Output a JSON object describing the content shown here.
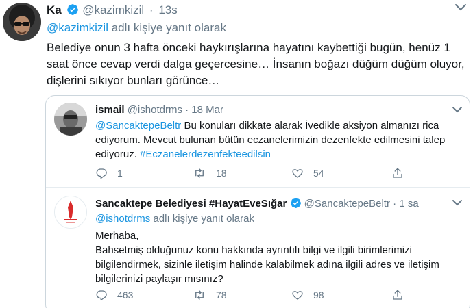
{
  "main_tweet": {
    "name": "Ka",
    "handle": "@kazimkizil",
    "separator": "·",
    "time": "13s",
    "reply_handle": "@kazimkizil",
    "reply_suffix": "adlı kişiye yanıt olarak",
    "text": "Belediye onun 3 hafta önceki haykırışlarına hayatını kaybettiği bugün, henüz 1 saat önce cevap verdi dalga geçercesine… İnsanın boğazı düğüm düğüm oluyor, dişlerini sıkıyor bunları görünce…"
  },
  "quoted_tweet_1": {
    "name": "ismail",
    "handle": "@ishotdrms",
    "separator": "·",
    "time": "18 Mar",
    "mention": "@SancaktepeBeltr",
    "text_part1": " Bu konuları dikkate alarak İvedikle aksiyon almanızı rica ediyorum. Mevcut bulunan bütün eczanelerimizin dezenfekte edilmesini talep ediyoruz. ",
    "hashtag": "#Eczanelerdezenfekteedilsin",
    "stats": {
      "replies": "1",
      "retweets": "18",
      "likes": "54"
    }
  },
  "quoted_tweet_2": {
    "name": "Sancaktepe Belediyesi #HayatEveSığar",
    "handle": "@SancaktepeBeltr",
    "separator": "·",
    "time": "1 sa",
    "reply_handle": "@ishotdrms",
    "reply_suffix": "adlı kişiye yanıt olarak",
    "greeting": "Merhaba,",
    "text": "Bahsetmiş olduğunuz konu hakkında ayrıntılı bilgi ve ilgili birimlerimizi bilgilendirmek, sizinle iletişim halinde kalabilmek adına ilgili adres ve iletişim bilgilerinizi paylaşır mısınız?",
    "stats": {
      "replies": "463",
      "retweets": "78",
      "likes": "98"
    }
  },
  "colors": {
    "link": "#1b95e0",
    "muted": "#657786",
    "verified": "#1da1f2",
    "logo_red": "#d92b2b"
  },
  "icons": [
    "verified-badge-icon",
    "chevron-down-icon",
    "reply-icon",
    "retweet-icon",
    "like-icon",
    "share-icon"
  ]
}
